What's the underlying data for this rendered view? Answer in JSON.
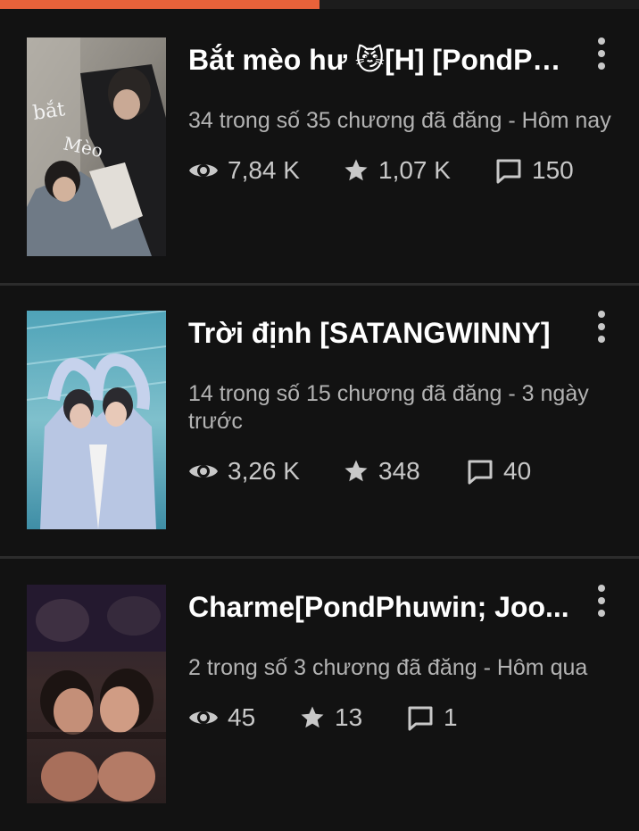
{
  "reading_progress": 0.5,
  "colors": {
    "accent": "#e8623a",
    "background": "#121212",
    "title": "#ffffff",
    "meta": "#b3b3b3",
    "stat": "#c8c8c8"
  },
  "stories": [
    {
      "title": "Bắt mèo hư 😼[H] [PondPh...",
      "meta": "34 trong số 35 chương đã đăng - Hôm nay",
      "cover_text": [
        "bắt",
        "Mèo"
      ],
      "stats": {
        "views": "7,84 K",
        "votes": "1,07 K",
        "comments": "150"
      }
    },
    {
      "title": "Trời định [SATANGWINNY]",
      "meta": "14 trong số 15 chương đã đăng - 3 ngày trước",
      "stats": {
        "views": "3,26 K",
        "votes": "348",
        "comments": "40"
      }
    },
    {
      "title": "Charme[PondPhuwin; Joo...",
      "meta": "2 trong số 3 chương đã đăng - Hôm qua",
      "stats": {
        "views": "45",
        "votes": "13",
        "comments": "1"
      }
    }
  ],
  "icons": {
    "views": "eye-icon",
    "votes": "star-icon",
    "comments": "comment-icon",
    "menu": "more-vertical-icon"
  }
}
